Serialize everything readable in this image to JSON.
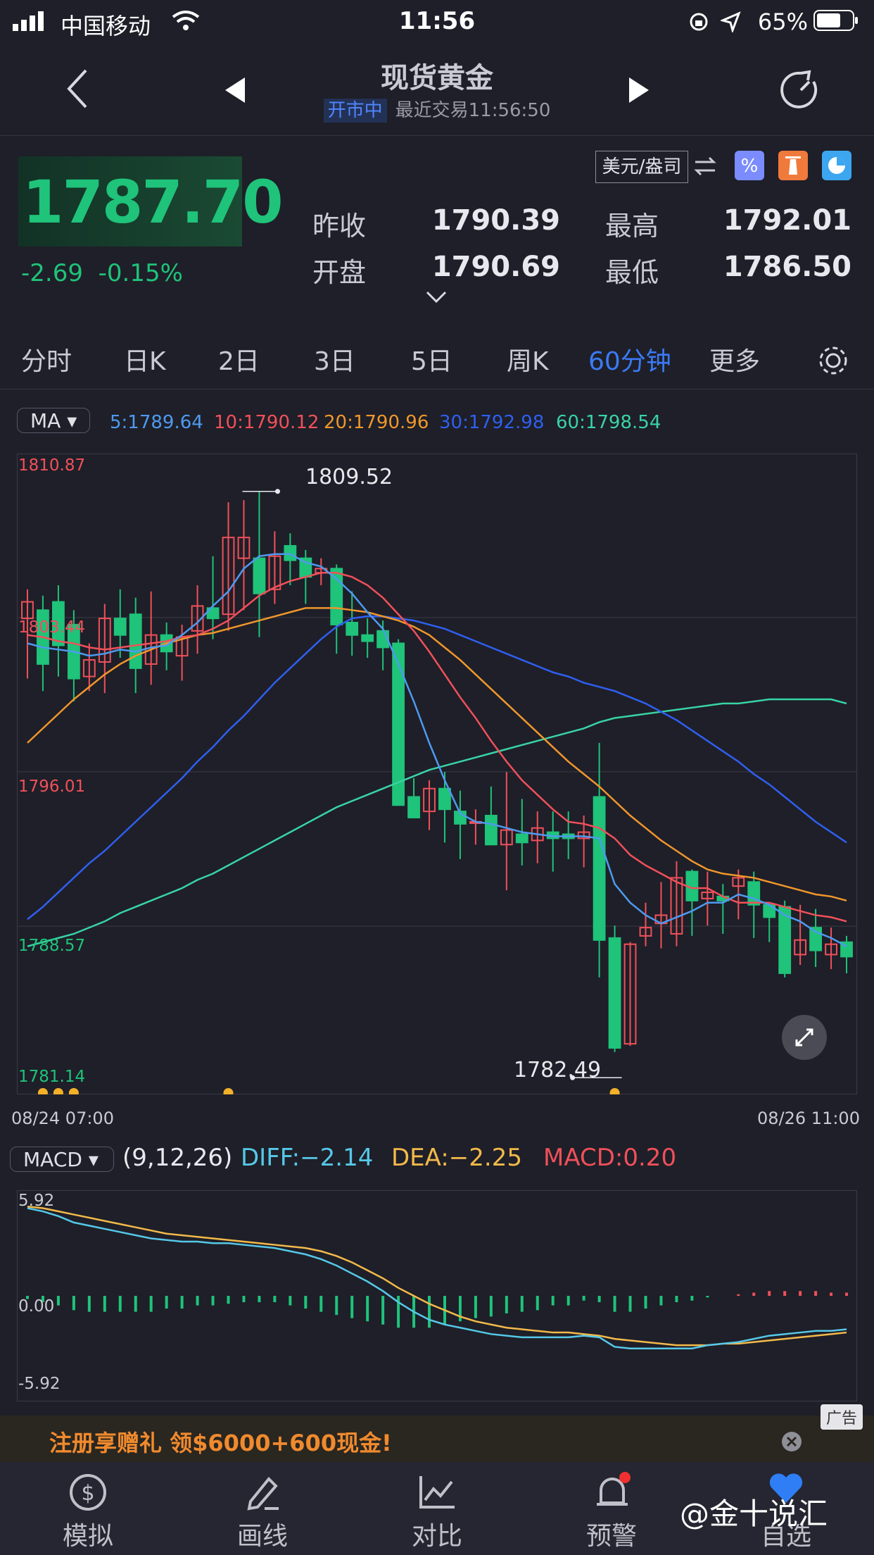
{
  "status_bar": {
    "carrier": "中国移动",
    "time": "11:56",
    "battery": "65%"
  },
  "header": {
    "title": "现货黄金",
    "market_status": "开市中",
    "last_trade": "最近交易11:56:50"
  },
  "quote": {
    "price": "1787.70",
    "change": "-2.69",
    "change_pct": "-0.15%",
    "currency": "美元/盎司",
    "prev_close_label": "昨收",
    "prev_close": "1790.39",
    "open_label": "开盘",
    "open": "1790.69",
    "high_label": "最高",
    "high": "1792.01",
    "low_label": "最低",
    "low": "1786.50"
  },
  "tabs": [
    "分时",
    "日K",
    "2日",
    "3日",
    "5日",
    "周K",
    "60分钟",
    "更多"
  ],
  "active_tab": "60分钟",
  "ma_selector": "MA",
  "ma_values": [
    {
      "label": "5:1789.64",
      "color": "#4e9af0"
    },
    {
      "label": "10:1790.12",
      "color": "#f0505a"
    },
    {
      "label": "20:1790.96",
      "color": "#f0962c"
    },
    {
      "label": "30:1792.98",
      "color": "#2f5ff0"
    },
    {
      "label": "60:1798.54",
      "color": "#39d3a5"
    }
  ],
  "y_axis": [
    "1810.87",
    "1803.44",
    "1796.01",
    "1788.57",
    "1781.14"
  ],
  "x_axis": {
    "start": "08/24 07:00",
    "end": "08/26 11:00"
  },
  "max_label": "1809.52",
  "min_label": "1782.49",
  "chart_data": {
    "type": "candlestick",
    "ylim": [
      1781.14,
      1810.87
    ],
    "candles": [
      [
        1803.4,
        1804.2,
        1800.5,
        1804.8
      ],
      [
        1803.8,
        1801.2,
        1799.9,
        1804.5
      ],
      [
        1804.2,
        1802.1,
        1800.6,
        1805.0
      ],
      [
        1803.1,
        1800.5,
        1799.4,
        1803.8
      ],
      [
        1800.6,
        1801.4,
        1799.9,
        1802.2
      ],
      [
        1801.3,
        1803.4,
        1799.8,
        1804.1
      ],
      [
        1803.4,
        1802.6,
        1801.5,
        1804.8
      ],
      [
        1803.6,
        1801.0,
        1799.8,
        1804.4
      ],
      [
        1801.2,
        1802.6,
        1800.2,
        1804.7
      ],
      [
        1802.6,
        1801.8,
        1800.9,
        1803.2
      ],
      [
        1801.6,
        1802.5,
        1800.4,
        1803.1
      ],
      [
        1802.8,
        1804.0,
        1801.7,
        1805.0
      ],
      [
        1803.9,
        1803.4,
        1802.4,
        1806.4
      ],
      [
        1803.6,
        1807.3,
        1802.8,
        1809.0
      ],
      [
        1806.3,
        1807.3,
        1803.8,
        1809.1
      ],
      [
        1806.3,
        1804.6,
        1802.5,
        1809.5
      ],
      [
        1804.8,
        1806.4,
        1804.1,
        1807.6
      ],
      [
        1806.9,
        1806.2,
        1805.0,
        1807.5
      ],
      [
        1806.3,
        1805.4,
        1804.1,
        1806.7
      ],
      [
        1805.6,
        1805.8,
        1805.0,
        1806.3
      ],
      [
        1805.8,
        1803.1,
        1801.7,
        1806.0
      ],
      [
        1803.2,
        1802.6,
        1801.6,
        1804.7
      ],
      [
        1802.6,
        1802.3,
        1801.5,
        1803.4
      ],
      [
        1802.8,
        1802.0,
        1800.9,
        1803.3
      ],
      [
        1802.2,
        1794.4,
        1794.7,
        1802.4
      ],
      [
        1794.8,
        1793.8,
        1794.1,
        1795.7
      ],
      [
        1794.1,
        1795.2,
        1793.2,
        1795.6
      ],
      [
        1795.2,
        1794.2,
        1792.6,
        1796.0
      ],
      [
        1794.1,
        1793.5,
        1791.8,
        1795.1
      ],
      [
        1793.6,
        1793.6,
        1792.5,
        1794.2
      ],
      [
        1793.9,
        1792.5,
        1792.5,
        1795.3
      ],
      [
        1792.5,
        1793.2,
        1790.3,
        1796.0
      ],
      [
        1793.0,
        1792.6,
        1791.5,
        1794.7
      ],
      [
        1792.7,
        1793.3,
        1791.6,
        1794.1
      ],
      [
        1793.1,
        1792.8,
        1791.2,
        1794.1
      ],
      [
        1793.0,
        1792.8,
        1791.8,
        1794.1
      ],
      [
        1792.8,
        1793.1,
        1791.4,
        1793.9
      ],
      [
        1794.8,
        1787.9,
        1786.1,
        1797.4
      ],
      [
        1788.0,
        1782.7,
        1782.5,
        1788.6
      ],
      [
        1782.9,
        1787.7,
        1782.8,
        1787.8
      ],
      [
        1788.1,
        1788.5,
        1787.6,
        1789.7
      ],
      [
        1788.7,
        1789.1,
        1787.5,
        1790.7
      ],
      [
        1788.2,
        1790.9,
        1787.6,
        1791.7
      ],
      [
        1791.2,
        1789.8,
        1788.1,
        1791.3
      ],
      [
        1789.9,
        1790.2,
        1788.6,
        1791.2
      ],
      [
        1790.0,
        1789.8,
        1788.2,
        1790.6
      ],
      [
        1790.5,
        1790.9,
        1788.9,
        1791.3
      ],
      [
        1790.7,
        1789.6,
        1788.0,
        1791.2
      ],
      [
        1789.6,
        1789.0,
        1787.8,
        1789.7
      ],
      [
        1789.5,
        1786.3,
        1786.1,
        1789.8
      ],
      [
        1787.2,
        1787.9,
        1786.7,
        1789.6
      ],
      [
        1788.5,
        1787.4,
        1786.6,
        1789.4
      ],
      [
        1787.2,
        1787.7,
        1786.5,
        1788.5
      ],
      [
        1787.8,
        1787.1,
        1786.3,
        1788.1
      ]
    ],
    "ma5": [
      1802.2,
      1802.0,
      1801.9,
      1801.8,
      1801.6,
      1801.7,
      1801.9,
      1801.8,
      1802.0,
      1802.1,
      1802.6,
      1803.2,
      1804.0,
      1804.7,
      1805.8,
      1806.4,
      1806.5,
      1806.5,
      1806.1,
      1805.9,
      1805.3,
      1804.6,
      1803.7,
      1802.9,
      1801.2,
      1799.4,
      1797.4,
      1795.6,
      1794.0,
      1793.6,
      1793.5,
      1793.3,
      1793.1,
      1793.0,
      1792.9,
      1792.9,
      1792.9,
      1792.8,
      1790.6,
      1789.7,
      1789.1,
      1788.7,
      1789.0,
      1789.3,
      1789.7,
      1789.7,
      1790.1,
      1789.9,
      1789.6,
      1789.1,
      1788.8,
      1788.3,
      1788.0,
      1787.6
    ],
    "ma10": [
      1802.6,
      1802.5,
      1802.3,
      1802.2,
      1802.0,
      1801.9,
      1802.0,
      1802.1,
      1802.2,
      1802.3,
      1802.5,
      1802.6,
      1802.9,
      1803.3,
      1803.9,
      1804.5,
      1804.9,
      1805.2,
      1805.4,
      1805.6,
      1805.6,
      1805.4,
      1805.0,
      1804.4,
      1803.6,
      1802.8,
      1801.8,
      1800.7,
      1799.6,
      1798.6,
      1797.5,
      1796.5,
      1795.6,
      1794.9,
      1794.2,
      1793.6,
      1793.5,
      1793.3,
      1792.8,
      1792.0,
      1791.5,
      1791.1,
      1790.7,
      1790.4,
      1790.4,
      1790.0,
      1789.7,
      1789.7,
      1789.7,
      1789.5,
      1789.3,
      1789.1,
      1789.0,
      1788.8
    ],
    "ma20": [
      1797.4,
      1798.1,
      1798.8,
      1799.5,
      1800.1,
      1800.7,
      1801.2,
      1801.6,
      1801.9,
      1802.2,
      1802.4,
      1802.6,
      1802.7,
      1802.9,
      1803.1,
      1803.3,
      1803.5,
      1803.7,
      1803.9,
      1803.9,
      1803.9,
      1803.8,
      1803.7,
      1803.5,
      1803.3,
      1803.0,
      1802.6,
      1802.0,
      1801.4,
      1800.7,
      1800.0,
      1799.3,
      1798.6,
      1797.9,
      1797.2,
      1796.5,
      1795.9,
      1795.3,
      1794.6,
      1793.9,
      1793.3,
      1792.7,
      1792.2,
      1791.7,
      1791.3,
      1791.1,
      1791.0,
      1790.9,
      1790.7,
      1790.5,
      1790.3,
      1790.1,
      1790.0,
      1789.8
    ],
    "ma30": [
      1788.9,
      1789.5,
      1790.2,
      1790.9,
      1791.6,
      1792.2,
      1792.9,
      1793.6,
      1794.3,
      1795.0,
      1795.7,
      1796.5,
      1797.2,
      1798.0,
      1798.7,
      1799.5,
      1800.3,
      1801.0,
      1801.7,
      1802.4,
      1803.0,
      1803.4,
      1803.5,
      1803.5,
      1803.4,
      1803.3,
      1803.1,
      1802.9,
      1802.6,
      1802.3,
      1802.0,
      1801.7,
      1801.4,
      1801.1,
      1800.8,
      1800.6,
      1800.3,
      1800.1,
      1799.9,
      1799.6,
      1799.3,
      1798.9,
      1798.5,
      1798.0,
      1797.5,
      1797.0,
      1796.5,
      1795.9,
      1795.4,
      1794.8,
      1794.2,
      1793.6,
      1793.1,
      1792.6
    ],
    "ma60": [
      1787.6,
      1787.8,
      1788.0,
      1788.2,
      1788.5,
      1788.8,
      1789.2,
      1789.5,
      1789.8,
      1790.1,
      1790.4,
      1790.8,
      1791.1,
      1791.5,
      1791.9,
      1792.3,
      1792.7,
      1793.1,
      1793.5,
      1793.9,
      1794.3,
      1794.6,
      1794.9,
      1795.2,
      1795.5,
      1795.8,
      1796.1,
      1796.3,
      1796.5,
      1796.7,
      1796.9,
      1797.1,
      1797.3,
      1797.5,
      1797.7,
      1797.9,
      1798.1,
      1798.4,
      1798.6,
      1798.7,
      1798.8,
      1798.9,
      1799.0,
      1799.1,
      1799.2,
      1799.3,
      1799.3,
      1799.4,
      1799.5,
      1799.5,
      1799.5,
      1799.5,
      1799.5,
      1799.3
    ]
  },
  "macd": {
    "selector": "MACD",
    "params": "(9,12,26)",
    "diff_label": "DIFF:−2.14",
    "dea_label": "DEA:−2.25",
    "macd_label": "MACD:0.20",
    "y_axis": [
      "5.92",
      "0.00",
      "-5.92"
    ],
    "ylim": [
      -5.92,
      5.92
    ],
    "diff": [
      5.5,
      5.3,
      5.0,
      4.6,
      4.4,
      4.2,
      4.0,
      3.8,
      3.6,
      3.5,
      3.4,
      3.4,
      3.3,
      3.3,
      3.2,
      3.1,
      3.0,
      2.8,
      2.6,
      2.3,
      1.9,
      1.4,
      0.9,
      0.3,
      -0.4,
      -1.0,
      -1.5,
      -1.8,
      -2.0,
      -2.2,
      -2.4,
      -2.5,
      -2.6,
      -2.6,
      -2.6,
      -2.6,
      -2.5,
      -2.6,
      -3.2,
      -3.3,
      -3.3,
      -3.3,
      -3.3,
      -3.3,
      -3.1,
      -3.0,
      -2.9,
      -2.7,
      -2.5,
      -2.4,
      -2.3,
      -2.2,
      -2.2,
      -2.1
    ],
    "dea": [
      5.6,
      5.5,
      5.3,
      5.1,
      4.9,
      4.7,
      4.5,
      4.3,
      4.1,
      3.9,
      3.8,
      3.7,
      3.6,
      3.5,
      3.4,
      3.3,
      3.2,
      3.1,
      3.0,
      2.8,
      2.5,
      2.1,
      1.6,
      1.1,
      0.5,
      0.0,
      -0.5,
      -0.9,
      -1.3,
      -1.6,
      -1.8,
      -2.0,
      -2.1,
      -2.2,
      -2.3,
      -2.3,
      -2.4,
      -2.5,
      -2.7,
      -2.8,
      -2.9,
      -3.0,
      -3.1,
      -3.1,
      -3.1,
      -3.0,
      -3.0,
      -2.9,
      -2.8,
      -2.7,
      -2.6,
      -2.5,
      -2.4,
      -2.3
    ],
    "hist": [
      -0.2,
      -0.4,
      -0.6,
      -0.9,
      -1.0,
      -1.0,
      -1.0,
      -1.0,
      -1.0,
      -0.8,
      -0.8,
      -0.6,
      -0.6,
      -0.5,
      -0.4,
      -0.4,
      -0.4,
      -0.6,
      -0.8,
      -1.0,
      -1.2,
      -1.4,
      -1.6,
      -1.8,
      -2.0,
      -2.0,
      -2.0,
      -1.8,
      -1.6,
      -1.4,
      -1.3,
      -1.1,
      -1.0,
      -0.9,
      -0.6,
      -0.6,
      -0.3,
      -0.4,
      -1.0,
      -1.0,
      -0.8,
      -0.6,
      -0.4,
      -0.3,
      -0.1,
      0.0,
      0.1,
      0.2,
      0.3,
      0.3,
      0.3,
      0.3,
      0.2,
      0.2
    ]
  },
  "ad": {
    "text": "注册享赠礼 领$6000+600现金!",
    "tag": "广告"
  },
  "bottom_nav": [
    {
      "label": "模拟",
      "icon": "dollar-icon"
    },
    {
      "label": "画线",
      "icon": "pen-icon"
    },
    {
      "label": "对比",
      "icon": "compare-chart-icon"
    },
    {
      "label": "预警",
      "icon": "alarm-icon"
    },
    {
      "label": "自选",
      "icon": "heart-icon"
    }
  ],
  "watermark": "@金十说汇",
  "colors": {
    "up": "#f0505a",
    "down": "#1fc37a",
    "accent": "#3a7af5",
    "background": "#1e1f28"
  }
}
